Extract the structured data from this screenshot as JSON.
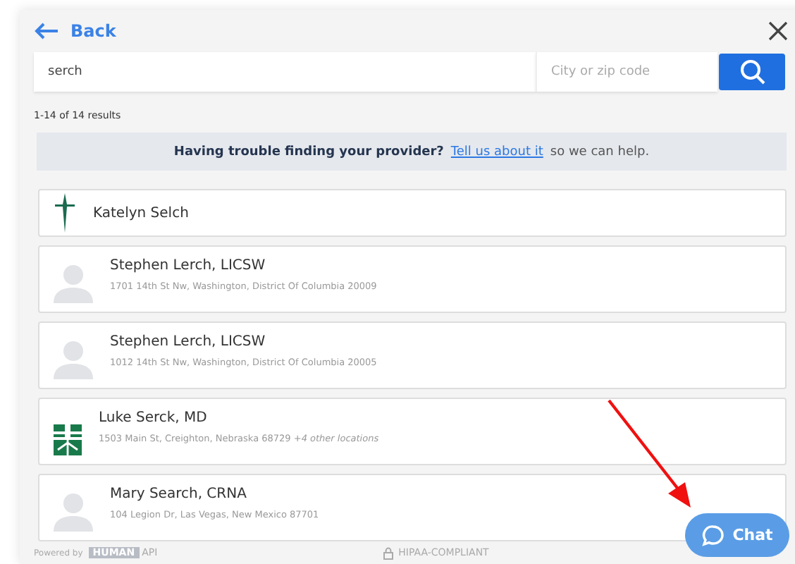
{
  "header": {
    "back": "Back"
  },
  "search": {
    "value": "serch",
    "location_placeholder": "City or zip code"
  },
  "results_count": "1-14 of 14 results",
  "banner": {
    "question": "Having trouble finding your provider?",
    "link": "Tell us about it",
    "rest": "so we can help."
  },
  "providers": [
    {
      "kind": "cross",
      "name": "Katelyn Selch"
    },
    {
      "kind": "person",
      "name": "Stephen Lerch, LICSW",
      "address": "1701 14th St Nw, Washington, District Of Columbia 20009"
    },
    {
      "kind": "person",
      "name": "Stephen Lerch, LICSW",
      "address": "1012 14th St Nw, Washington, District Of Columbia 20005"
    },
    {
      "kind": "grid",
      "name": "Luke Serck, MD",
      "address": "1503 Main St, Creighton, Nebraska 68729 *+4 other locations*"
    },
    {
      "kind": "person",
      "name": "Mary Search, CRNA",
      "address": "104 Legion Dr, Las Vegas, New Mexico 87701"
    }
  ],
  "footer": {
    "powered_by": "Powered by",
    "brand_box": "HUMAN",
    "brand_rest": "API",
    "compliance": "HIPAA-COMPLIANT"
  },
  "chat": {
    "label": "Chat"
  }
}
